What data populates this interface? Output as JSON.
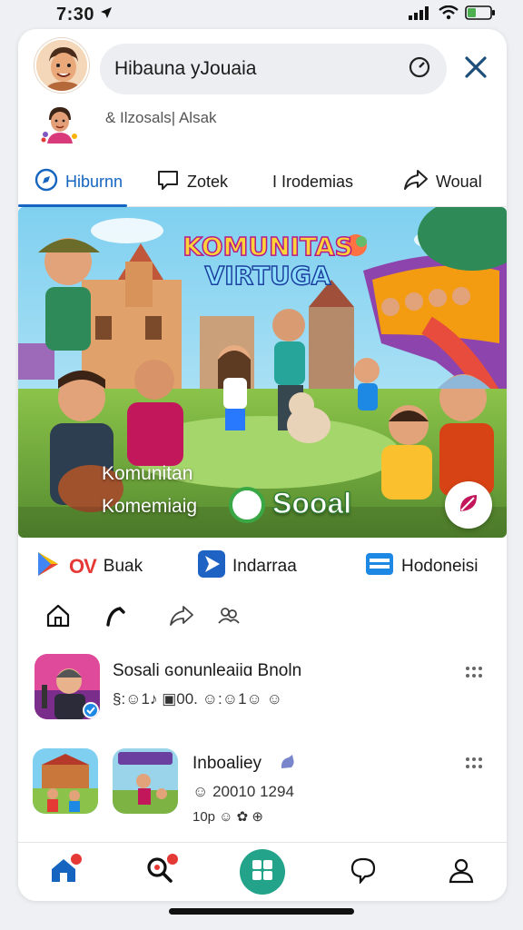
{
  "status_bar": {
    "time": "7:30"
  },
  "header": {
    "search_text": "Hibauna yJouaia",
    "subline": "& Ilzosals|  Alsak"
  },
  "tabs": [
    {
      "label": "Hiburnn",
      "icon": "compass-icon",
      "active": true
    },
    {
      "label": "Zotek",
      "icon": "chat-icon"
    },
    {
      "label": "I Irodemias",
      "icon": ""
    },
    {
      "label": "Woual",
      "icon": "share-icon"
    }
  ],
  "banner": {
    "title_line1": "KOMUNITAS",
    "title_line2": "VIRTUGA",
    "caption_line1": "Komunitan",
    "caption_line2": "Komemiaig",
    "caption_bold": "Sooal"
  },
  "apps": [
    {
      "symbol": "OV",
      "label": "Buak",
      "icon": "play-store-icon"
    },
    {
      "label": "Indarraa",
      "icon": "arrow-app-icon"
    },
    {
      "label": "Hodoneisi",
      "icon": "mail-app-icon"
    }
  ],
  "posts": [
    {
      "title": "Sosali ɢonunleaiiɑ Bnoln",
      "meta": "§:☺1♪  ▣00.  ☺:☺1☺ ☺"
    },
    {
      "title": "Inboaliey",
      "meta": "☺ 20010 1294",
      "meta2": "10p ☺ ✿ ⊕"
    }
  ],
  "colors": {
    "accent": "#1565c0",
    "brand_green": "#22a38a",
    "alert_red": "#e53935"
  }
}
